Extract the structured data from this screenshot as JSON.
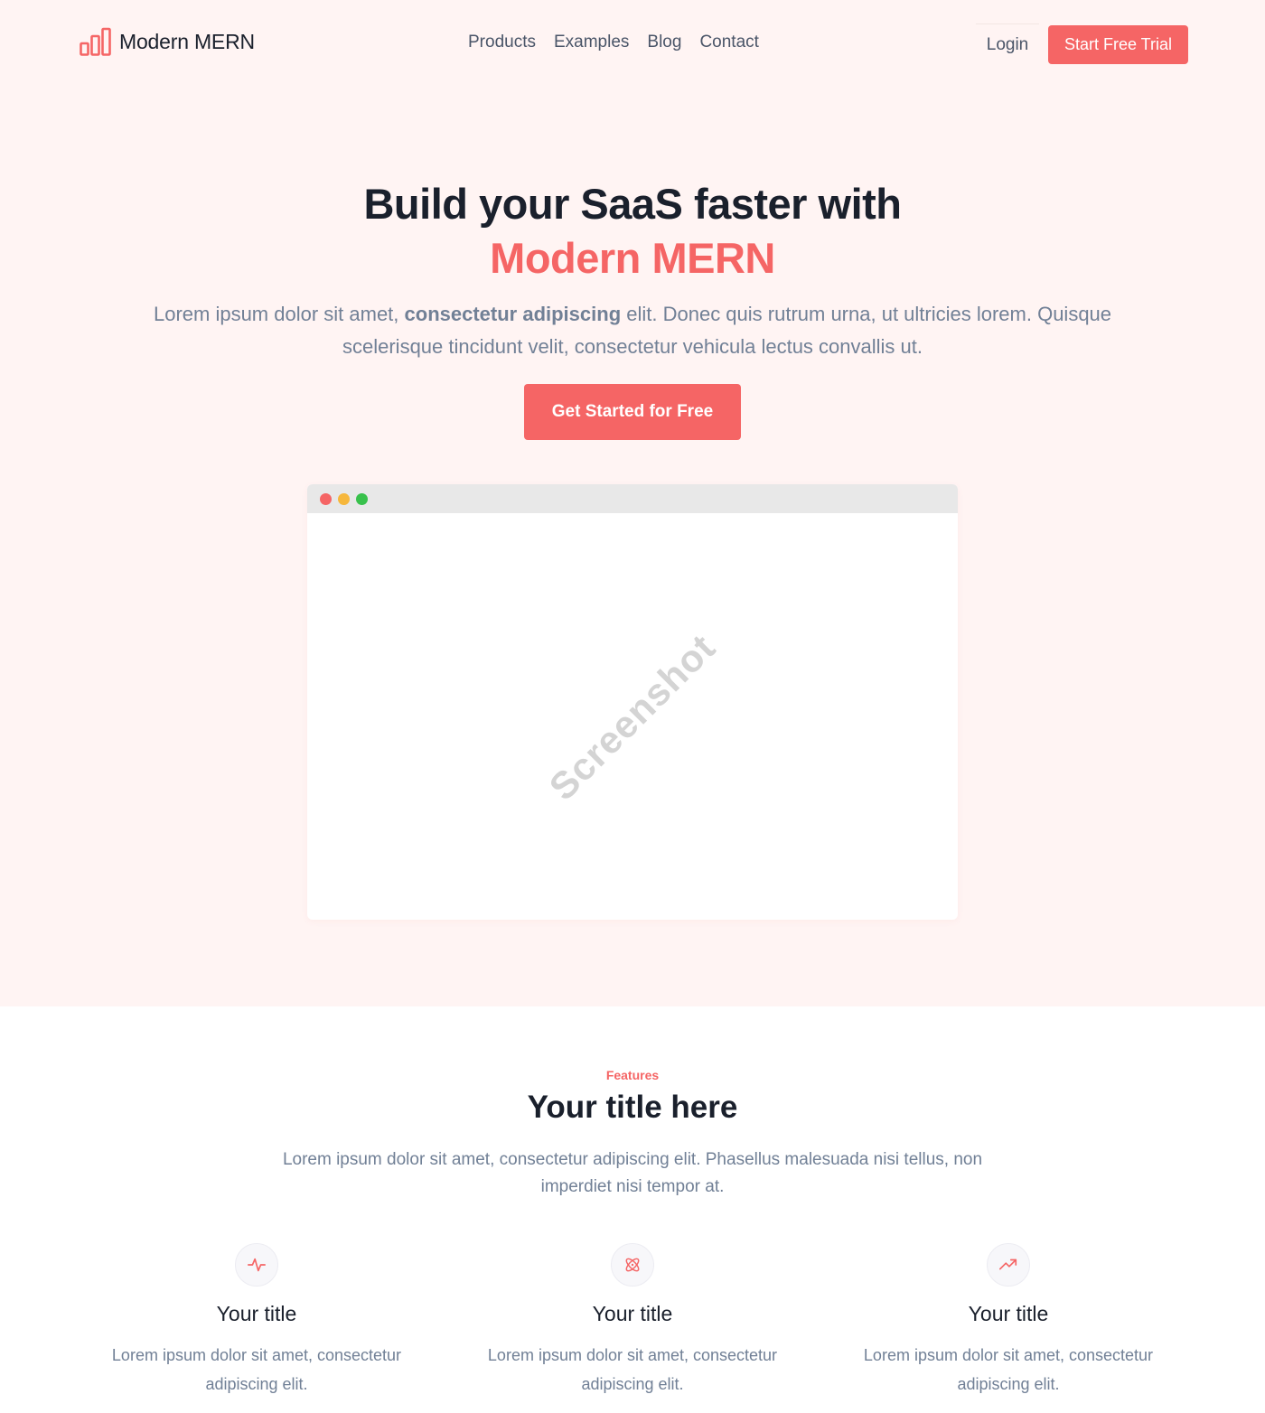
{
  "brand": {
    "name": "Modern MERN",
    "icon": "bar-chart-icon",
    "color": "#f56565"
  },
  "nav": {
    "links": [
      "Products",
      "Examples",
      "Blog",
      "Contact"
    ],
    "login": "Login",
    "trial": "Start Free Trial"
  },
  "hero": {
    "title_line1": "Build your SaaS faster with",
    "title_accent": "Modern MERN",
    "sub_part1": "Lorem ipsum dolor sit amet, ",
    "sub_bold": "consectetur adipiscing",
    "sub_part2": " elit. Donec quis rutrum urna, ut ultricies lorem. Quisque scelerisque tincidunt velit, consectetur vehicula lectus convallis ut.",
    "cta": "Get Started for Free",
    "screenshot_watermark": "Screenshot"
  },
  "features": {
    "eyebrow": "Features",
    "title": "Your title here",
    "description": "Lorem ipsum dolor sit amet, consectetur adipiscing elit. Phasellus malesuada nisi tellus, non imperdiet nisi tempor at.",
    "items": [
      {
        "icon": "activity-icon",
        "title": "Your title",
        "text": "Lorem ipsum dolor sit amet, consectetur adipiscing elit."
      },
      {
        "icon": "atom-icon",
        "title": "Your title",
        "text": "Lorem ipsum dolor sit amet, consectetur adipiscing elit."
      },
      {
        "icon": "trending-up-icon",
        "title": "Your title",
        "text": "Lorem ipsum dolor sit amet, consectetur adipiscing elit."
      }
    ]
  },
  "colors": {
    "accent": "#f56565",
    "hero_bg": "#fff4f3",
    "heading": "#1a202c",
    "muted": "#718096"
  }
}
